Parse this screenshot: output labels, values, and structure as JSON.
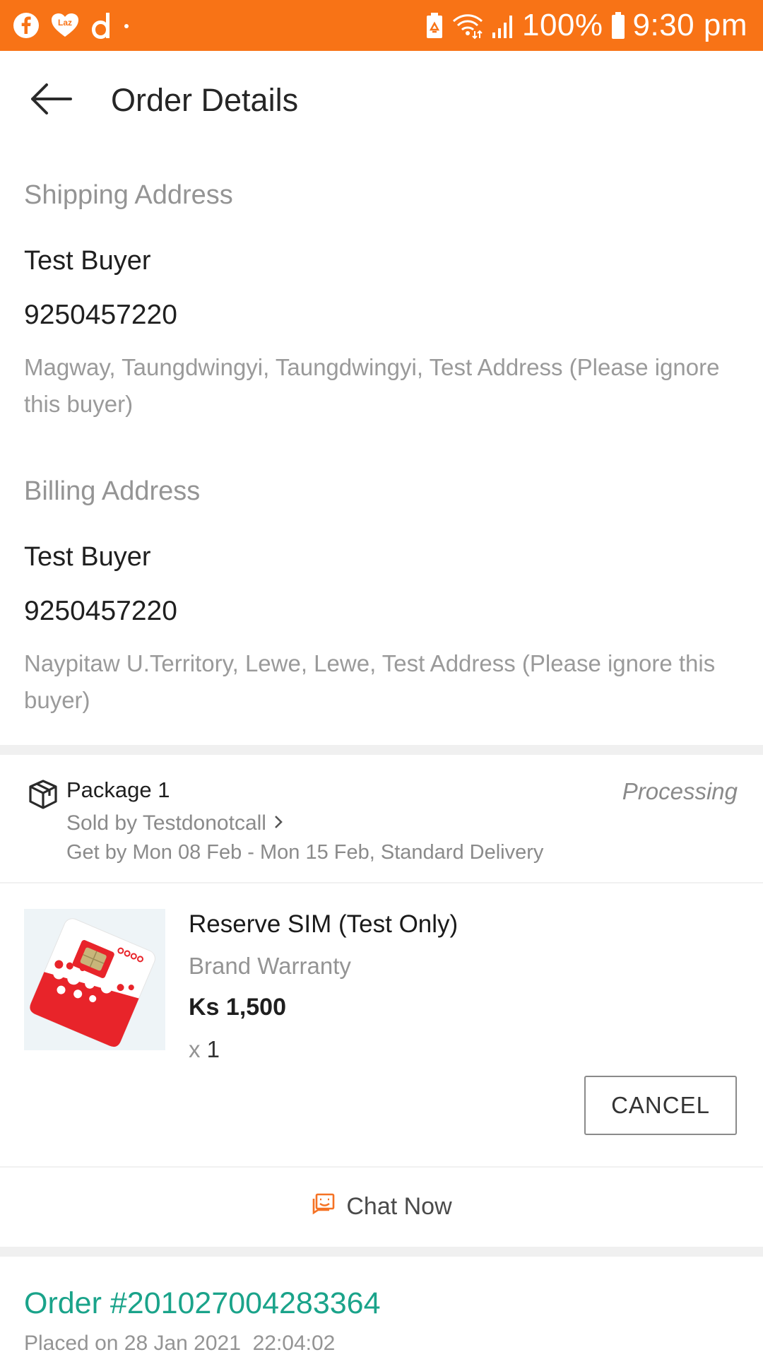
{
  "status_bar": {
    "bg_color": "#f87316",
    "left_icons": [
      "facebook-icon",
      "lazada-icon",
      "d-app-icon",
      "dot-icon"
    ],
    "right_icons": [
      "battery-saver-icon",
      "wifi-icon",
      "signal-icon",
      "battery-icon"
    ],
    "battery": "100%",
    "time": "9:30 pm"
  },
  "header": {
    "back_icon": "arrow-back-icon",
    "title": "Order Details"
  },
  "shipping": {
    "label": "Shipping Address",
    "name": "Test Buyer",
    "phone": "9250457220",
    "address": "Magway, Taungdwingyi, Taungdwingyi, Test Address (Please ignore this buyer)"
  },
  "billing": {
    "label": "Billing Address",
    "name": "Test Buyer",
    "phone": "9250457220",
    "address": "Naypitaw U.Territory, Lewe, Lewe, Test Address (Please ignore this buyer)"
  },
  "package": {
    "icon": "package-box-icon",
    "title": "Package 1",
    "status": "Processing",
    "seller": "Sold by Testdonotcall",
    "delivery": "Get by Mon 08 Feb - Mon 15 Feb, Standard Delivery"
  },
  "product": {
    "name": "Reserve SIM (Test Only)",
    "warranty": "Brand Warranty",
    "price": "Ks 1,500",
    "qty_prefix": "x",
    "qty": "1",
    "image_colors": [
      "#e8242a",
      "#ffffff"
    ]
  },
  "actions": {
    "cancel": "CANCEL",
    "chat": "Chat Now",
    "chat_icon": "chat-icon",
    "accent": "#f57224"
  },
  "order": {
    "number": "Order #201027004283364",
    "placed_on": "Placed on 28 Jan 2021  22:04:02",
    "number_color": "#1aa38a"
  }
}
